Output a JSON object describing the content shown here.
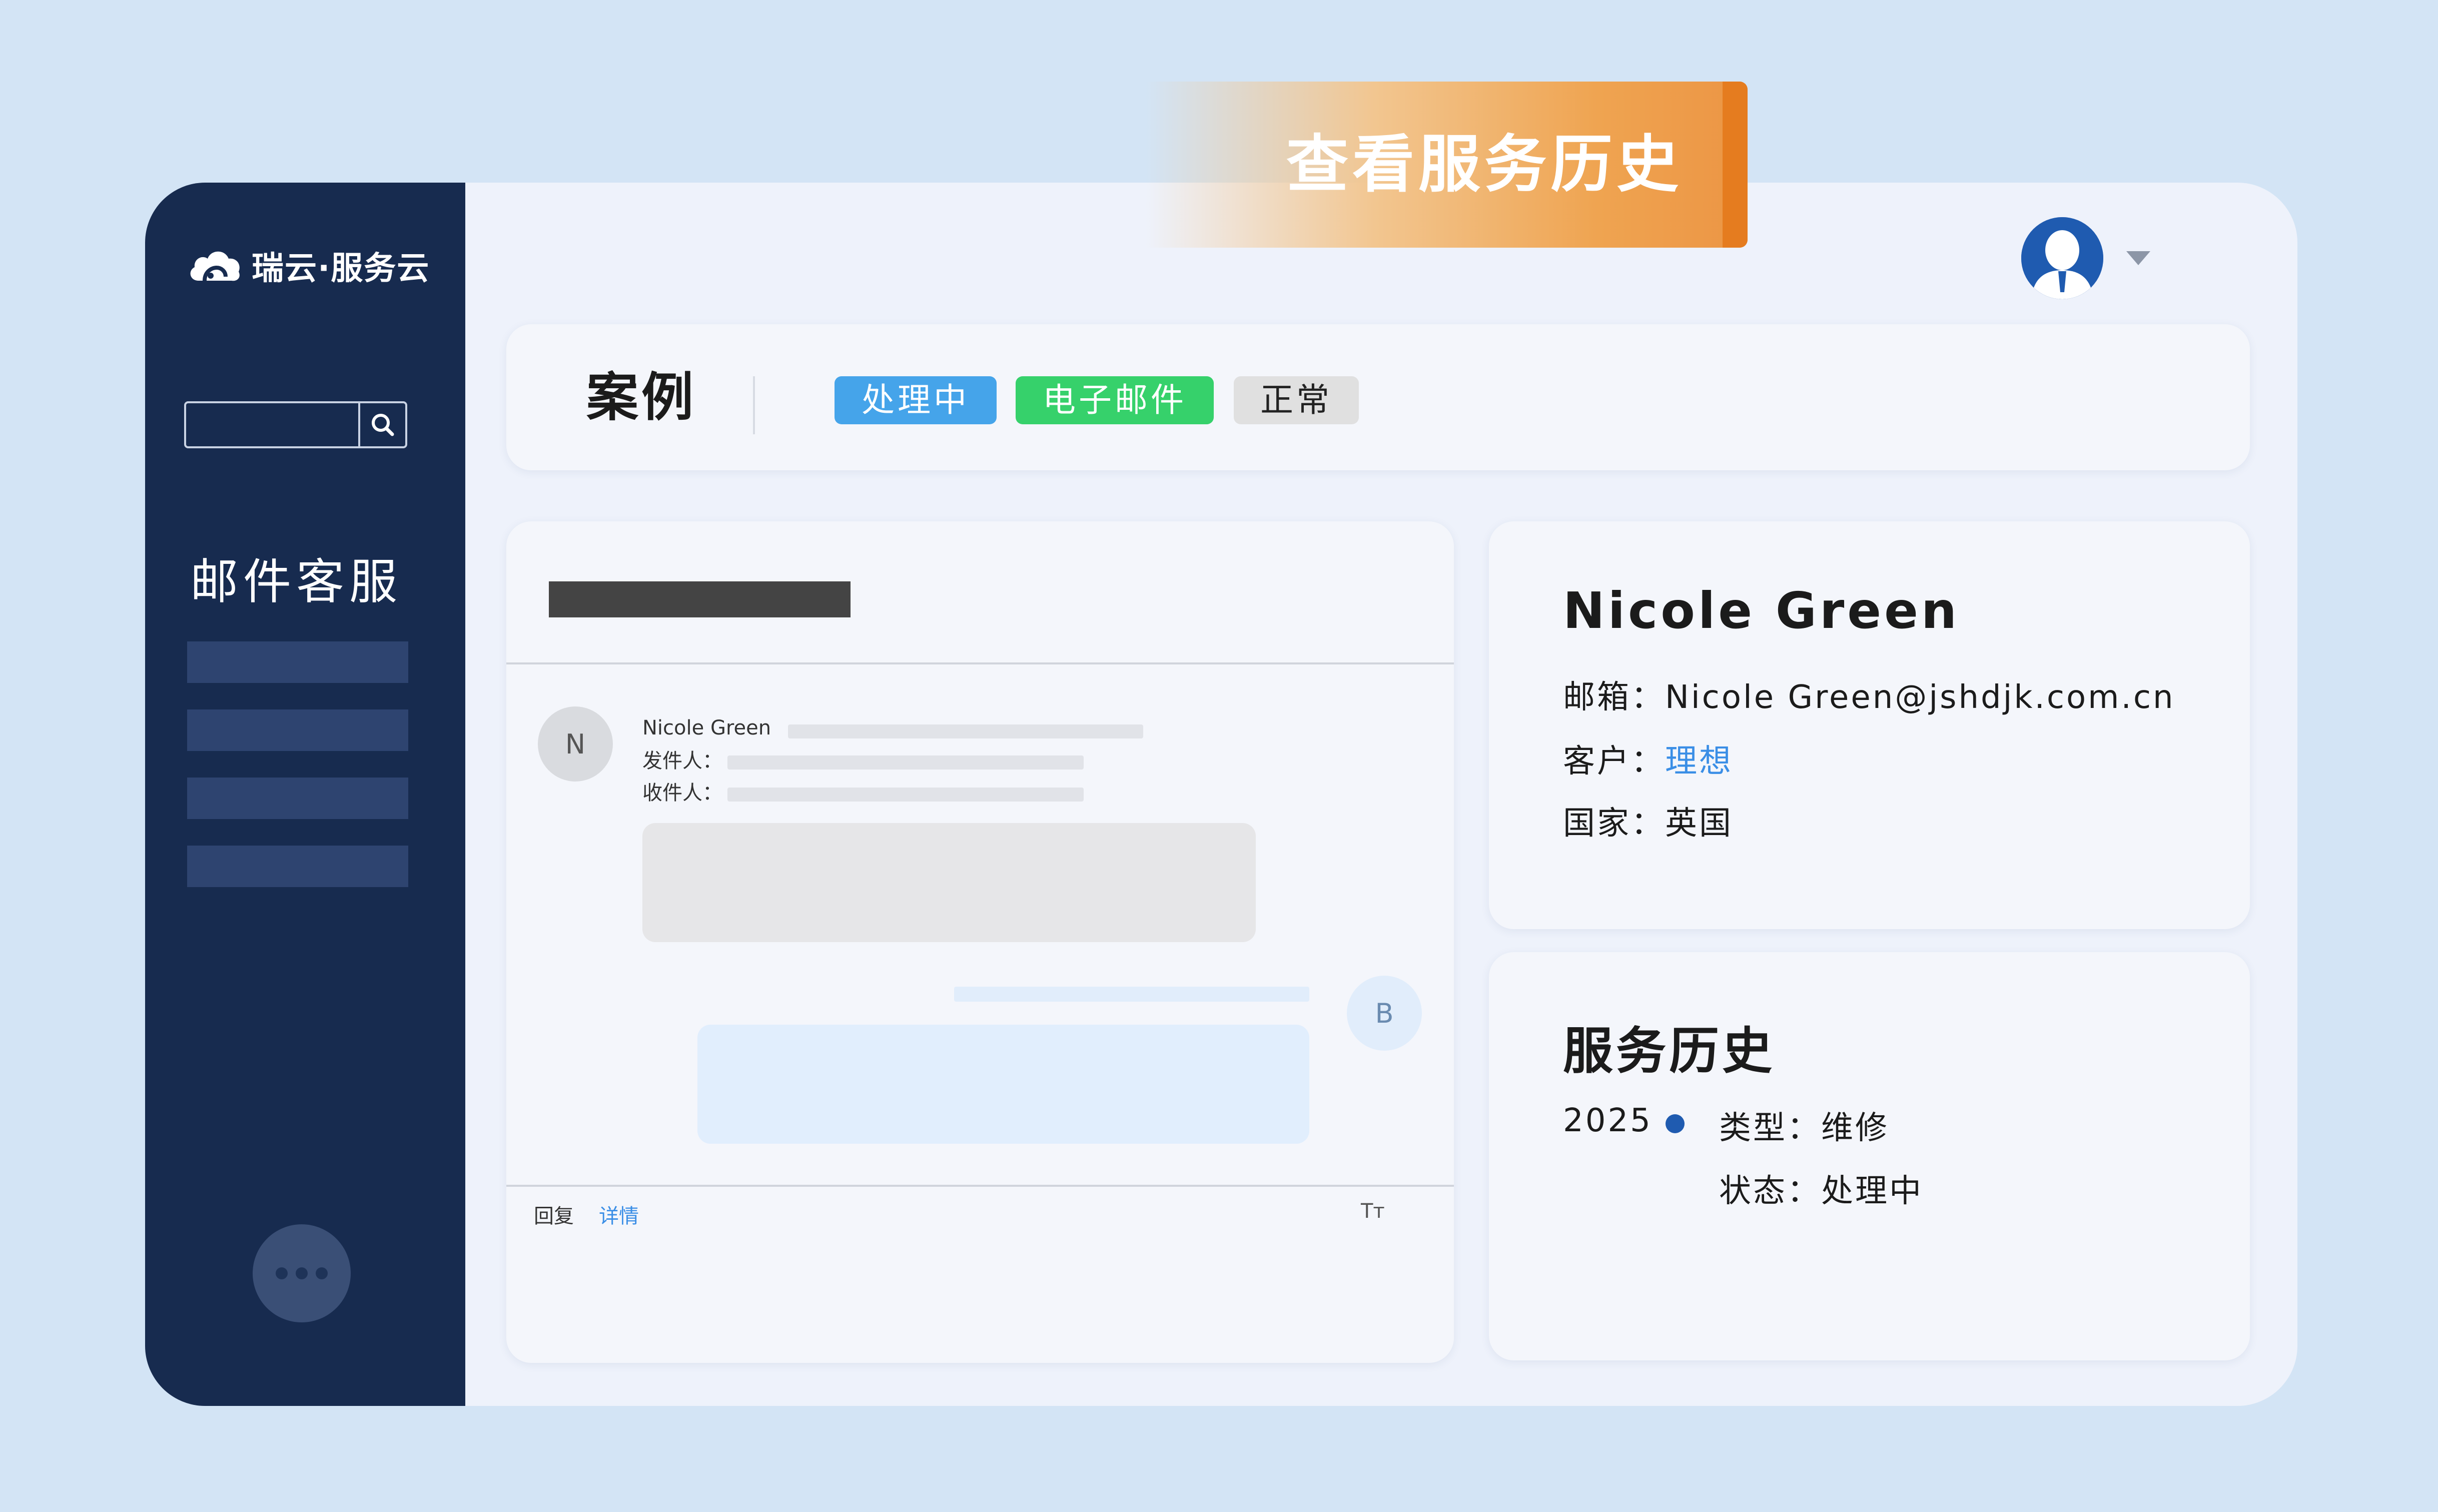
{
  "banner": {
    "title": "查看服务历史"
  },
  "sidebar": {
    "logo_text": "瑞云·服务云",
    "search": {
      "value": "",
      "placeholder": ""
    },
    "section_title": "邮件客服",
    "items": [
      "",
      "",
      "",
      ""
    ]
  },
  "case": {
    "title": "案例",
    "tags": [
      {
        "label": "处理中",
        "bg": "#45a4ea",
        "color": "#ffffff"
      },
      {
        "label": "电子邮件",
        "bg": "#36d16b",
        "color": "#ffffff"
      },
      {
        "label": "正常",
        "bg": "#e0e0e0",
        "color": "#222222"
      }
    ]
  },
  "email": {
    "sender_avatar": "N",
    "sender_name": "Nicole Green",
    "from_label": "发件人：",
    "to_label": "收件人：",
    "reply_avatar": "B",
    "footer": {
      "reply": "回复",
      "details": "详情",
      "format_icon": "Tт"
    }
  },
  "customer": {
    "name": "Nicole Green",
    "email_label": "邮箱：",
    "email": "Nicole Green@jshdjk.com.cn",
    "client_label": "客户：",
    "client": "理想",
    "country_label": "国家：",
    "country": "英国"
  },
  "history": {
    "title": "服务历史",
    "year": "2025",
    "type_label": "类型：",
    "type": "维修",
    "status_label": "状态：",
    "status": "处理中"
  },
  "colors": {
    "sidebar": "#172b4f",
    "accent_blue": "#3a8ee6",
    "banner_orange": "#e57c1f"
  }
}
